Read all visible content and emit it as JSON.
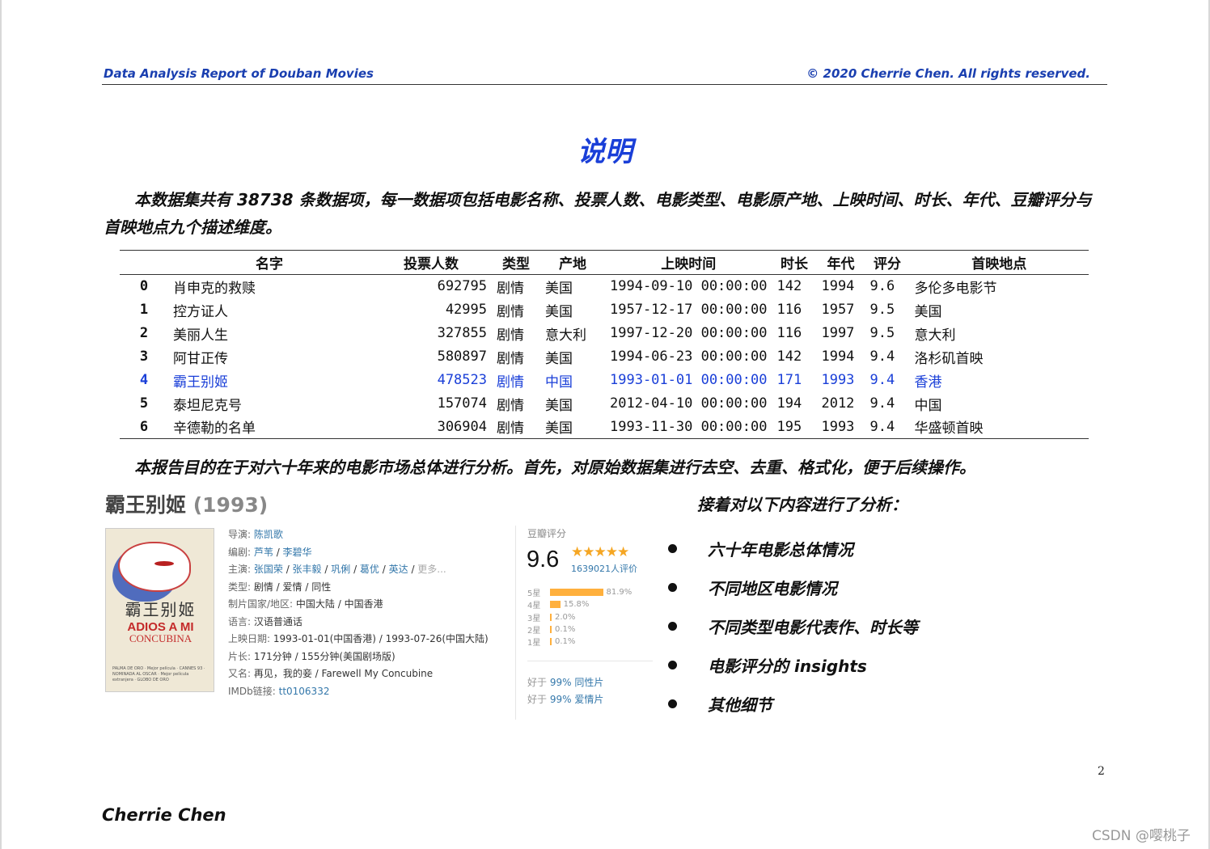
{
  "header": {
    "left": "Data Analysis Report of Douban Movies",
    "right": "© 2020 Cherrie Chen. All rights reserved."
  },
  "title": "说明",
  "intro": "本数据集共有 38738 条数据项，每一数据项包括电影名称、投票人数、电影类型、电影原产地、上映时间、时长、年代、豆瓣评分与首映地点九个描述维度。",
  "table": {
    "headers": {
      "name": "名字",
      "votes": "投票人数",
      "type": "类型",
      "region": "产地",
      "date": "上映时间",
      "length": "时长",
      "year": "年代",
      "score": "评分",
      "place": "首映地点"
    },
    "rows": [
      {
        "idx": "0",
        "name": "肖申克的救赎",
        "votes": "692795",
        "type": "剧情",
        "region": "美国",
        "date": "1994-09-10 00:00:00",
        "length": "142",
        "year": "1994",
        "score": "9.6",
        "place": "多伦多电影节"
      },
      {
        "idx": "1",
        "name": "控方证人",
        "votes": "42995",
        "type": "剧情",
        "region": "美国",
        "date": "1957-12-17 00:00:00",
        "length": "116",
        "year": "1957",
        "score": "9.5",
        "place": "美国"
      },
      {
        "idx": "2",
        "name": "美丽人生",
        "votes": "327855",
        "type": "剧情",
        "region": "意大利",
        "date": "1997-12-20 00:00:00",
        "length": "116",
        "year": "1997",
        "score": "9.5",
        "place": "意大利"
      },
      {
        "idx": "3",
        "name": "阿甘正传",
        "votes": "580897",
        "type": "剧情",
        "region": "美国",
        "date": "1994-06-23 00:00:00",
        "length": "142",
        "year": "1994",
        "score": "9.4",
        "place": "洛杉矶首映"
      },
      {
        "idx": "4",
        "name": "霸王别姬",
        "votes": "478523",
        "type": "剧情",
        "region": "中国",
        "date": "1993-01-01 00:00:00",
        "length": "171",
        "year": "1993",
        "score": "9.4",
        "place": "香港"
      },
      {
        "idx": "5",
        "name": "泰坦尼克号",
        "votes": "157074",
        "type": "剧情",
        "region": "美国",
        "date": "2012-04-10 00:00:00",
        "length": "194",
        "year": "2012",
        "score": "9.4",
        "place": "中国"
      },
      {
        "idx": "6",
        "name": "辛德勒的名单",
        "votes": "306904",
        "type": "剧情",
        "region": "美国",
        "date": "1993-11-30 00:00:00",
        "length": "195",
        "year": "1993",
        "score": "9.4",
        "place": "华盛顿首映"
      }
    ],
    "highlight_color": "#1a3fd8"
  },
  "purpose": "本报告目的在于对六十年来的电影市场总体进行分析。首先，对原始数据集进行去空、去重、格式化，便于后续操作。",
  "card": {
    "title": "霸王别姬",
    "year": "(1993)",
    "poster": {
      "cn": "霸王别姬",
      "en1": "ADIOS A MI",
      "en2": "CONCUBINA",
      "small": "PALMA DE ORO · Mejor película · CANNES 93 · NOMINADA AL OSCAR · Mejor película extranjera · GLOBO DE ORO"
    },
    "info": {
      "director_k": "导演: ",
      "director": "陈凯歌",
      "writer_k": "编剧: ",
      "writer1": "芦苇",
      "writer_sep": " / ",
      "writer2": "李碧华",
      "cast_k": "主演: ",
      "cast1": "张国荣",
      "cast2": "张丰毅",
      "cast3": "巩俐",
      "cast4": "葛优",
      "cast5": "英达",
      "sep": " / ",
      "more": "更多...",
      "genre_k": "类型: ",
      "genre": "剧情 / 爱情 / 同性",
      "country_k": "制片国家/地区: ",
      "country": "中国大陆 / 中国香港",
      "lang_k": "语言: ",
      "lang": "汉语普通话",
      "release_k": "上映日期: ",
      "release": "1993-01-01(中国香港) / 1993-07-26(中国大陆)",
      "length_k": "片长: ",
      "length": "171分钟 / 155分钟(美国剧场版)",
      "aka_k": "又名: ",
      "aka": "再见，我的妾 / Farewell My Concubine",
      "imdb_k": "IMDb链接: ",
      "imdb": "tt0106332"
    },
    "rating": {
      "label": "豆瓣评分",
      "score": "9.6",
      "stars": "★★★★★",
      "votes": "1639021人评价",
      "dist": [
        {
          "label": "5星",
          "pct": 81.9,
          "text": "81.9%"
        },
        {
          "label": "4星",
          "pct": 15.8,
          "text": "15.8%"
        },
        {
          "label": "3星",
          "pct": 2.0,
          "text": "2.0%"
        },
        {
          "label": "2星",
          "pct": 0.1,
          "text": "0.1%"
        },
        {
          "label": "1星",
          "pct": 0.1,
          "text": "0.1%"
        }
      ],
      "better1_pre": "好于 ",
      "better1_lnk": "99% 同性片",
      "better2_pre": "好于 ",
      "better2_lnk": "99% 爱情片"
    }
  },
  "analysis": {
    "title": "接着对以下内容进行了分析：",
    "points": [
      "六十年电影总体情况",
      "不同地区电影情况",
      "不同类型电影代表作、时长等",
      "电影评分的 insights",
      "其他细节"
    ]
  },
  "page_number": "2",
  "author": "Cherrie Chen",
  "watermark": "CSDN @嘤桃子"
}
